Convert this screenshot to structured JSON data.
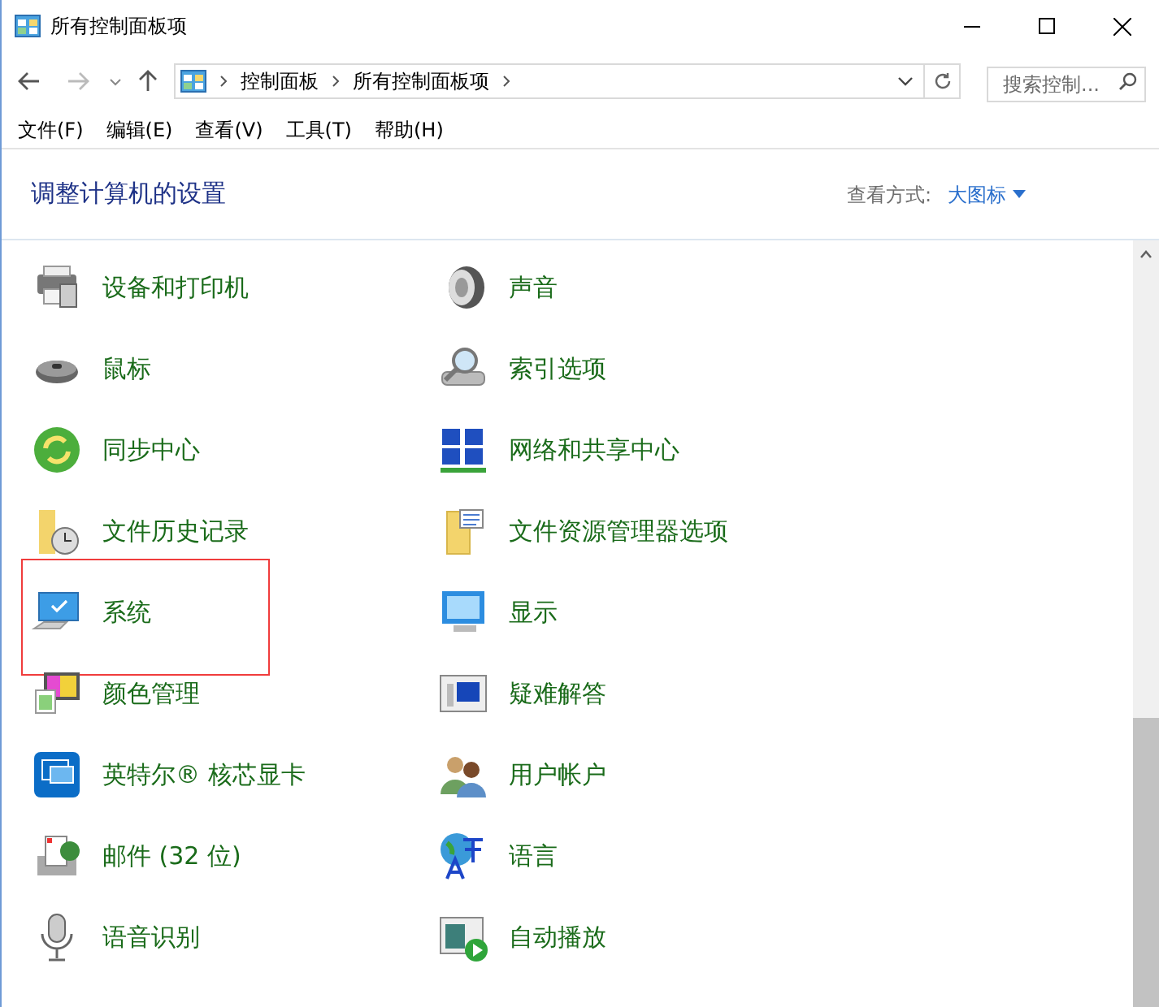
{
  "window": {
    "title": "所有控制面板项"
  },
  "address_bar": {
    "crumbs": [
      "控制面板",
      "所有控制面板项"
    ]
  },
  "search": {
    "placeholder": "搜索控制..."
  },
  "menu": [
    "文件(F)",
    "编辑(E)",
    "查看(V)",
    "工具(T)",
    "帮助(H)"
  ],
  "heading": "调整计算机的设置",
  "view_by": {
    "label": "查看方式:",
    "value": "大图标"
  },
  "items": [
    {
      "label": "设备和打印机",
      "highlighted": false
    },
    {
      "label": "声音",
      "highlighted": false
    },
    {
      "label": "鼠标",
      "highlighted": false
    },
    {
      "label": "索引选项",
      "highlighted": false
    },
    {
      "label": "同步中心",
      "highlighted": false
    },
    {
      "label": "网络和共享中心",
      "highlighted": false
    },
    {
      "label": "文件历史记录",
      "highlighted": false
    },
    {
      "label": "文件资源管理器选项",
      "highlighted": false
    },
    {
      "label": "系统",
      "highlighted": true
    },
    {
      "label": "显示",
      "highlighted": false
    },
    {
      "label": "颜色管理",
      "highlighted": false
    },
    {
      "label": "疑难解答",
      "highlighted": false
    },
    {
      "label": "英特尔® 核芯显卡",
      "highlighted": false
    },
    {
      "label": "用户帐户",
      "highlighted": false
    },
    {
      "label": "邮件 (32 位)",
      "highlighted": false
    },
    {
      "label": "语言",
      "highlighted": false
    },
    {
      "label": "语音识别",
      "highlighted": false
    },
    {
      "label": "自动播放",
      "highlighted": false
    }
  ]
}
